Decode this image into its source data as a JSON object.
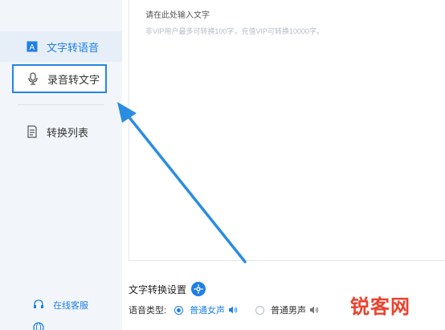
{
  "sidebar": {
    "items": [
      {
        "label": "文字转语音",
        "icon": "text-A-icon"
      },
      {
        "label": "录音转文字",
        "icon": "microphone-icon"
      },
      {
        "label": "转换列表",
        "icon": "list-document-icon"
      }
    ],
    "bottom": [
      {
        "label": "在线客服",
        "icon": "headset-icon"
      },
      {
        "label": "",
        "icon": "globe-icon"
      }
    ]
  },
  "editor": {
    "placeholder_title": "请在此处输入文字",
    "placeholder_note": "非VIP用户最多可转换100字，充值VIP可转换10000字。"
  },
  "settings": {
    "title": "文字转换设置",
    "voice_type_label": "语音类型:",
    "voices": [
      {
        "label": "普通女声",
        "selected": true
      },
      {
        "label": "普通男声",
        "selected": false
      }
    ]
  },
  "watermark": {
    "text": "锐客网",
    "sub": ""
  },
  "colors": {
    "accent": "#1f7fe5",
    "sidebar_bg": "#f2f6fb",
    "arrow": "#2b8de0",
    "watermark": "#e8422e"
  }
}
